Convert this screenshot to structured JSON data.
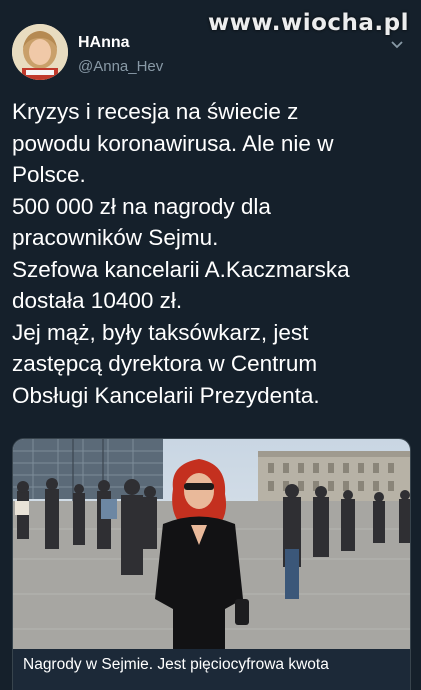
{
  "watermark": "www.wiocha.pl",
  "tweet": {
    "display_name": "HAnna",
    "handle": "@Anna_Hev",
    "lines": [
      "Kryzys i recesja na świecie z",
      "powodu koronawirusa. Ale nie w",
      "Polsce.",
      "500 000 zł na nagrody dla",
      "pracowników Sejmu.",
      "Szefowa kancelarii A.Kaczmarska",
      "dostała 10400 zł.",
      "Jej mąż, były taksówkarz, jest",
      "zastępcą dyrektora w Centrum",
      "Obsługi Kancelarii Prezydenta."
    ]
  },
  "card": {
    "title": "Nagrody w Sejmie. Jest pięciocyfrowa kwota"
  },
  "icons": {
    "menu": "chevron-down-icon",
    "avatar": "profile-photo"
  },
  "colors": {
    "background": "#15202b",
    "secondary_text": "#8899a6",
    "border": "#38444d"
  }
}
